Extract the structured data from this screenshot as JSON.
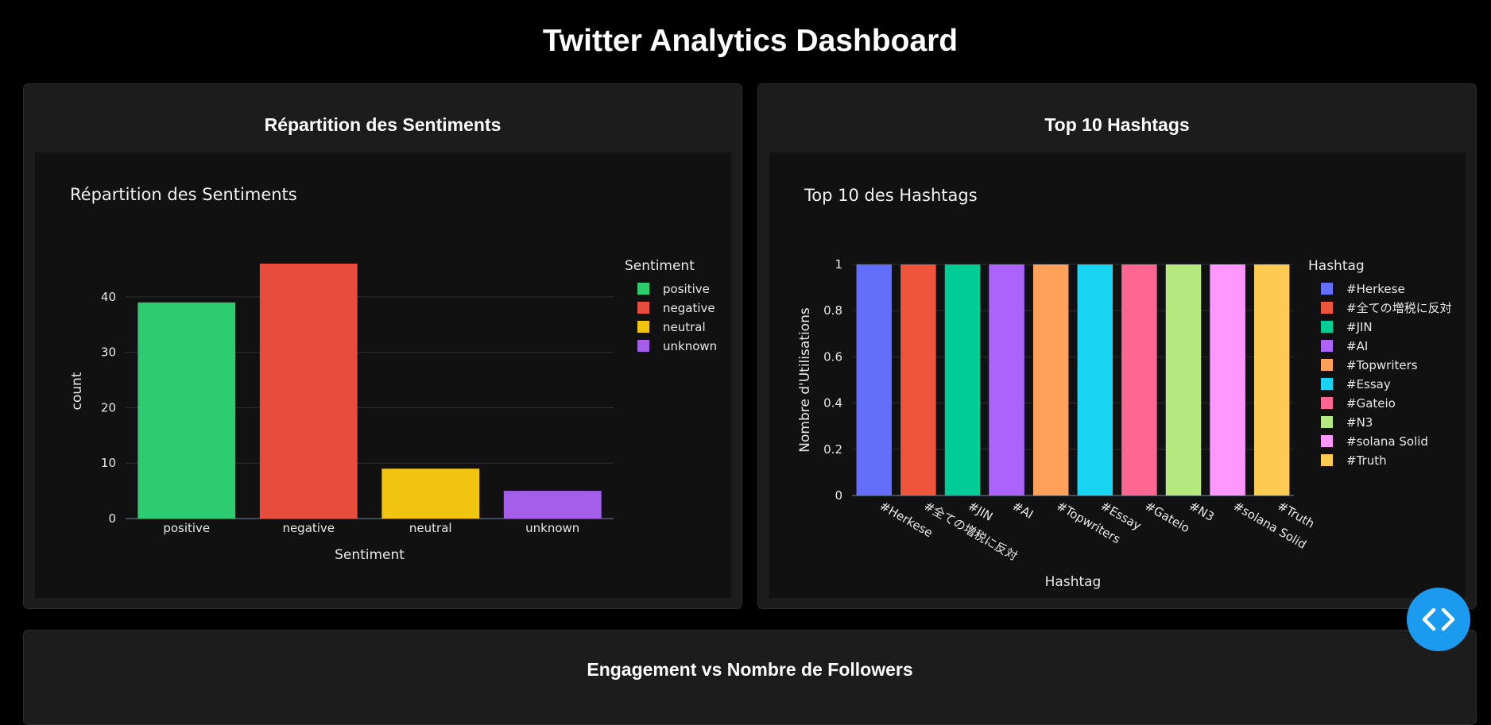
{
  "page": {
    "title": "Twitter Analytics Dashboard"
  },
  "cards": {
    "sentiment": {
      "title": "Répartition des Sentiments"
    },
    "hashtags": {
      "title": "Top 10 Hashtags"
    },
    "engagement": {
      "title": "Engagement vs Nombre de Followers"
    }
  },
  "fab": {
    "icon": "code-icon"
  },
  "colors": {
    "page_bg": "#000000",
    "card_bg": "#1c1c1c",
    "plot_bg": "#111111",
    "fab": "#1a9bf0"
  },
  "chart_data": [
    {
      "type": "bar",
      "title": "Répartition des Sentiments",
      "xlabel": "Sentiment",
      "ylabel": "count",
      "categories": [
        "positive",
        "negative",
        "neutral",
        "unknown"
      ],
      "values": [
        39,
        46,
        9,
        5
      ],
      "colors": [
        "#2ecc71",
        "#e74c3c",
        "#f1c40f",
        "#a55eea"
      ],
      "yticks": [
        0,
        10,
        20,
        30,
        40
      ],
      "ylim": [
        0,
        46
      ],
      "legend": {
        "title": "Sentiment",
        "placement": "right"
      },
      "grid": true
    },
    {
      "type": "bar",
      "title": "Top 10 des Hashtags",
      "xlabel": "Hashtag",
      "ylabel": "Nombre d'Utilisations",
      "categories": [
        "#Herkese",
        "#全ての増税に反対",
        "#JIN",
        "#AI",
        "#Topwriters",
        "#Essay",
        "#Gateio",
        "#N3",
        "#solana Solid",
        "#Truth"
      ],
      "values": [
        1,
        1,
        1,
        1,
        1,
        1,
        1,
        1,
        1,
        1
      ],
      "colors": [
        "#636efa",
        "#ef553b",
        "#00cc96",
        "#ab63fa",
        "#ffa15a",
        "#19d3f3",
        "#ff6692",
        "#b6e880",
        "#ff97ff",
        "#fecb52"
      ],
      "yticks": [
        "0",
        "0.2",
        "0.4",
        "0.6",
        "0.8",
        "1"
      ],
      "ylim": [
        0,
        1
      ],
      "legend": {
        "title": "Hashtag",
        "placement": "right"
      },
      "grid": true
    }
  ]
}
